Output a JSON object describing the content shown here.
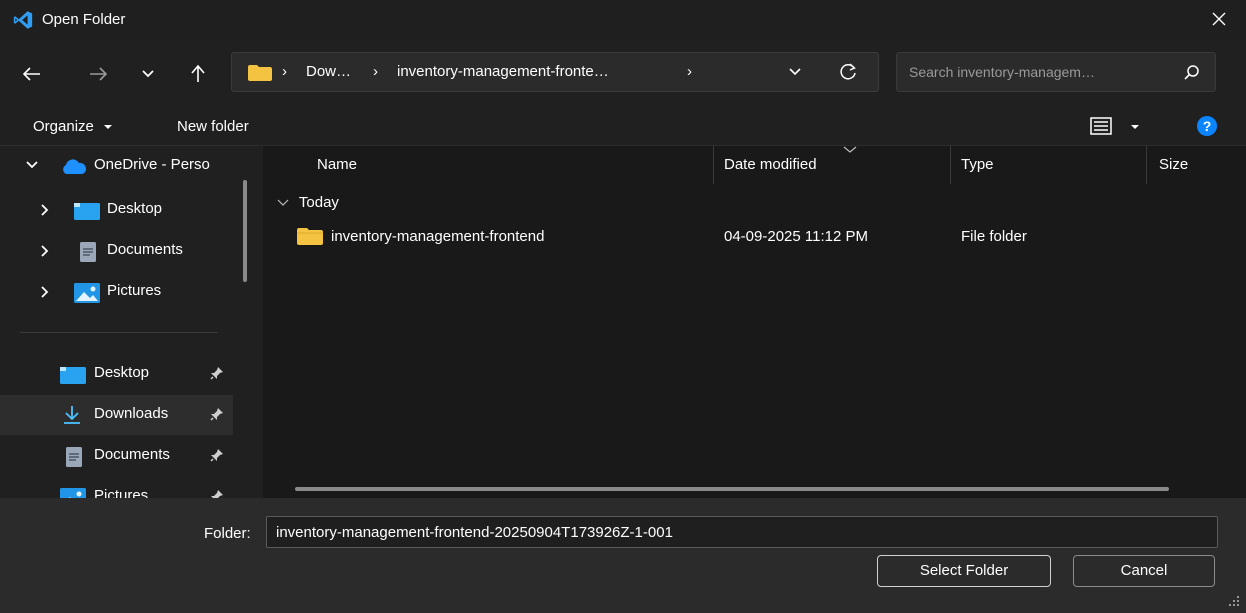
{
  "window": {
    "title": "Open Folder"
  },
  "address": {
    "crumbs": [
      "Dow…",
      "inventory-management-fronte…"
    ],
    "separator": "›"
  },
  "search": {
    "placeholder": "Search inventory-managem…"
  },
  "commands": {
    "organize": "Organize",
    "new_folder": "New folder"
  },
  "sidebar": {
    "tree": [
      {
        "label": "OneDrive - Perso",
        "icon": "cloud-icon",
        "expanded": true
      },
      {
        "label": "Desktop",
        "icon": "desktop-icon"
      },
      {
        "label": "Documents",
        "icon": "document-icon"
      },
      {
        "label": "Pictures",
        "icon": "pictures-icon"
      }
    ],
    "quick_access": [
      {
        "label": "Desktop",
        "icon": "desktop-icon"
      },
      {
        "label": "Downloads",
        "icon": "download-icon"
      },
      {
        "label": "Documents",
        "icon": "document-icon"
      },
      {
        "label": "Pictures",
        "icon": "pictures-icon"
      }
    ]
  },
  "columns": {
    "name": "Name",
    "date_modified": "Date modified",
    "type": "Type",
    "size": "Size"
  },
  "groups": [
    {
      "label": "Today",
      "items": [
        {
          "name": "inventory-management-frontend",
          "date_modified": "04-09-2025 11:12 PM",
          "type": "File folder",
          "size": ""
        }
      ]
    }
  ],
  "footer": {
    "folder_label": "Folder:",
    "folder_value": "inventory-management-frontend-20250904T173926Z-1-001",
    "select_label": "Select Folder",
    "cancel_label": "Cancel"
  },
  "colors": {
    "folder_yellow": "#f5c342",
    "accent_blue": "#0a84ff",
    "download_green": "#4cc2ff"
  }
}
